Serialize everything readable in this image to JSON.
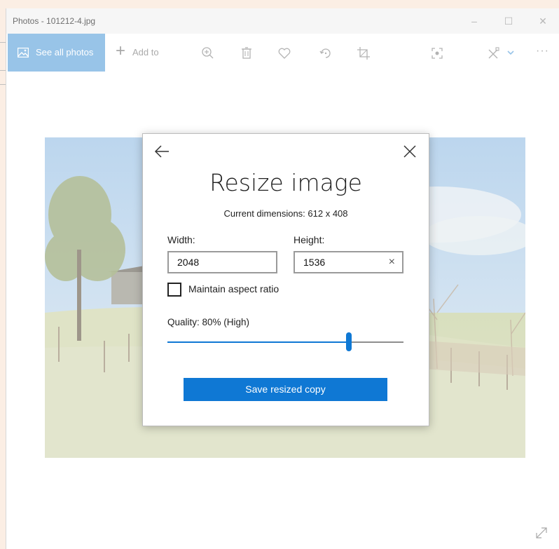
{
  "window": {
    "title": "Photos - 101212-4.jpg",
    "controls": {
      "minimize": "–",
      "maximize": "☐",
      "close": "✕"
    }
  },
  "toolbar": {
    "see_all_photos_label": "See all photos",
    "add_to_label": "Add to",
    "icons": [
      "zoom-in-icon",
      "delete-icon",
      "heart-icon",
      "rotate-icon",
      "crop-icon",
      "face-focus-icon",
      "edit-draw-icon",
      "more-icon"
    ],
    "more_label": "···"
  },
  "dialog": {
    "title": "Resize image",
    "current_dimensions": "Current dimensions: 612 x 408",
    "width_label": "Width:",
    "width_value": "2048",
    "height_label": "Height:",
    "height_value": "1536",
    "clear_glyph": "×",
    "maintain_aspect_label": "Maintain aspect ratio",
    "maintain_aspect_checked": false,
    "quality_label": "Quality: 80% (High)",
    "quality_percent": 80,
    "save_button_label": "Save resized copy"
  },
  "colors": {
    "accent": "#0f78d4",
    "selected_toolbar_button": "#98c4e8",
    "background": "#fbeee4"
  }
}
